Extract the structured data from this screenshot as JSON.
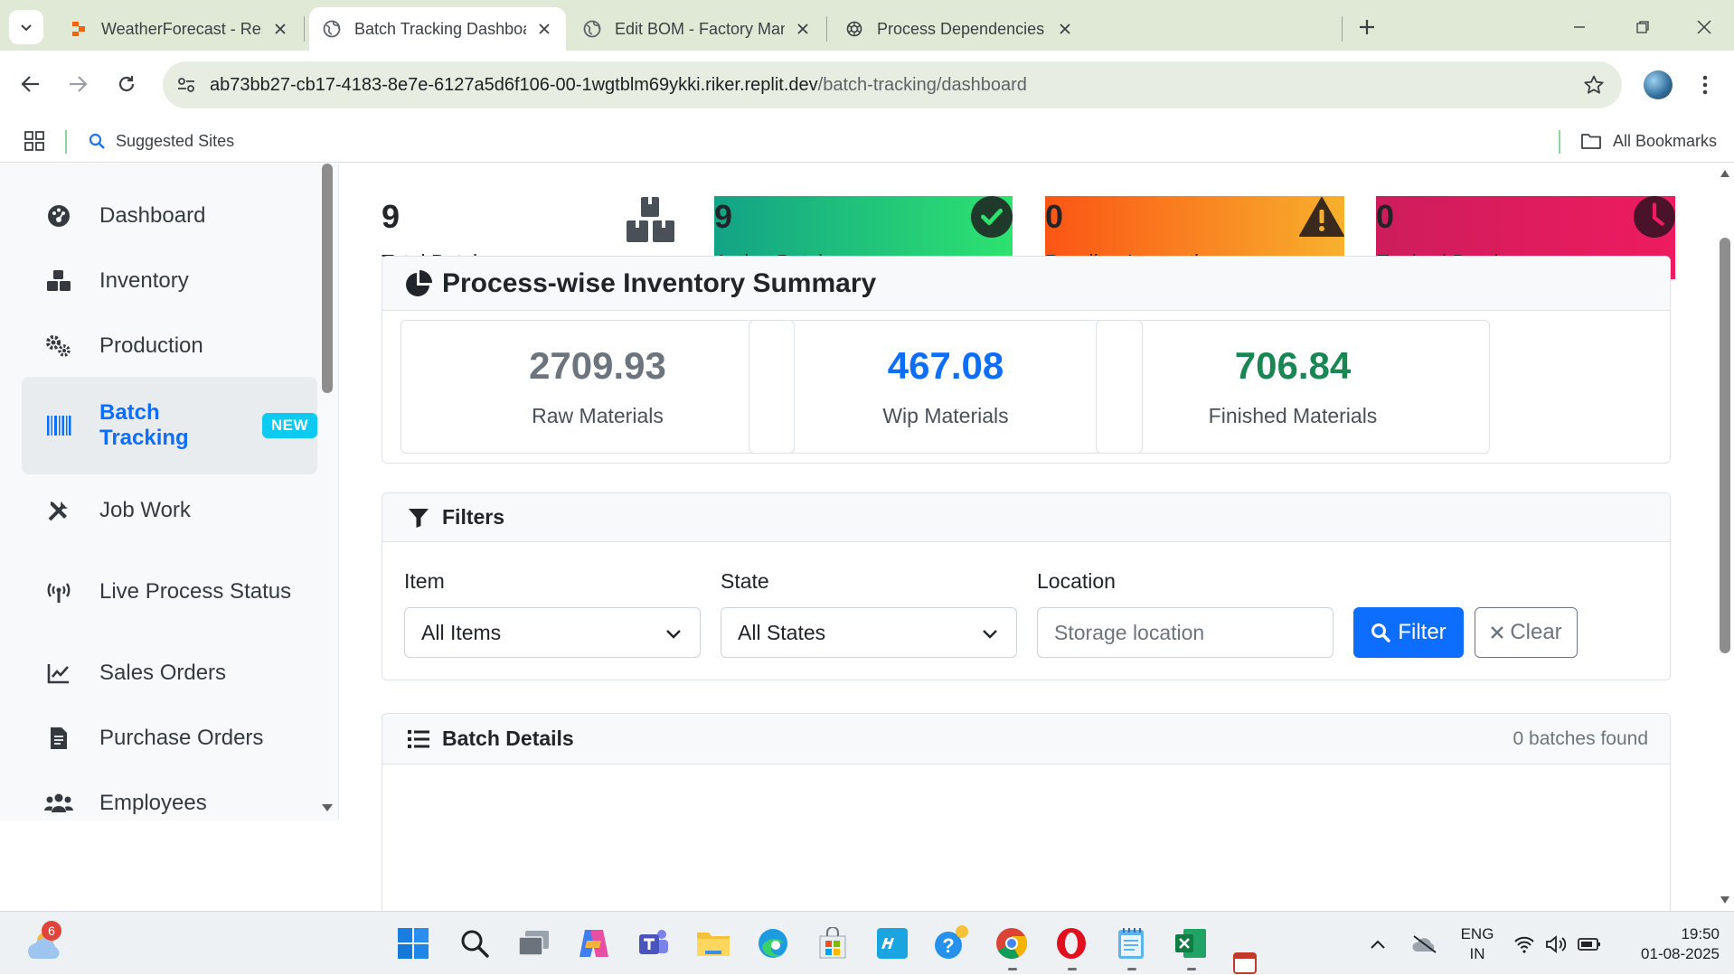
{
  "browser": {
    "tabs": [
      {
        "title": "WeatherForecast - Replit",
        "favicon": "replit-icon",
        "active": false
      },
      {
        "title": "Batch Tracking Dashboard",
        "favicon": "globe-icon",
        "active": true
      },
      {
        "title": "Edit BOM - Factory Managemer",
        "favicon": "globe-icon",
        "active": false
      },
      {
        "title": "Process Dependencies Overview",
        "favicon": "openai-icon",
        "active": false
      }
    ],
    "url_host": "ab73bb27-cb17-4183-8e7e-6127a5d6f106-00-1wgtblm69ykki.riker.replit.dev",
    "url_path": "/batch-tracking/dashboard",
    "bookmarks": {
      "suggested": "Suggested Sites",
      "all": "All Bookmarks"
    }
  },
  "sidebar": {
    "items": [
      {
        "label": "Dashboard",
        "icon": "palette-gauge-icon"
      },
      {
        "label": "Inventory",
        "icon": "boxes-icon"
      },
      {
        "label": "Production",
        "icon": "gears-icon"
      },
      {
        "label": "Batch Tracking",
        "icon": "barcode-icon",
        "badge": "NEW",
        "active": true
      },
      {
        "label": "Job Work",
        "icon": "tools-icon"
      },
      {
        "label": "Live Process Status",
        "icon": "broadcast-tower-icon"
      },
      {
        "label": "Sales Orders",
        "icon": "line-chart-icon"
      },
      {
        "label": "Purchase Orders",
        "icon": "file-invoice-icon"
      },
      {
        "label": "Employees",
        "icon": "users-icon"
      }
    ]
  },
  "stats": {
    "total": {
      "value": "9",
      "label": "Total Batches"
    },
    "active": {
      "value": "9",
      "label": "Active Batches"
    },
    "pending": {
      "value": "0",
      "label": "Pending Inspection"
    },
    "expired": {
      "value": "0",
      "label": "Expired Batches"
    }
  },
  "summary": {
    "title": "Process-wise Inventory Summary",
    "raw": {
      "value": "2709.93",
      "label": "Raw Materials",
      "color": "#6c757d"
    },
    "wip": {
      "value": "467.08",
      "label": "Wip Materials",
      "color": "#0d6efd"
    },
    "finished": {
      "value": "706.84",
      "label": "Finished Materials",
      "color": "#198754"
    }
  },
  "filters": {
    "title": "Filters",
    "item_label": "Item",
    "item_value": "All Items",
    "state_label": "State",
    "state_value": "All States",
    "location_label": "Location",
    "location_placeholder": "Storage location",
    "filter_button": "Filter",
    "clear_button": "Clear"
  },
  "batch_details": {
    "title": "Batch Details",
    "count_text": "0 batches found"
  },
  "taskbar": {
    "weather_badge": "6",
    "lang_line1": "ENG",
    "lang_line2": "IN",
    "time": "19:50",
    "date": "01-08-2025"
  },
  "colors": {
    "primary": "#0d6efd",
    "info_badge": "#0dcaf0",
    "active_gradient": [
      "#13a386",
      "#2de26f"
    ],
    "pending_gradient": [
      "#fb5514",
      "#f7b02d"
    ],
    "expired_gradient": [
      "#cd1d5b",
      "#ee1b60"
    ]
  }
}
